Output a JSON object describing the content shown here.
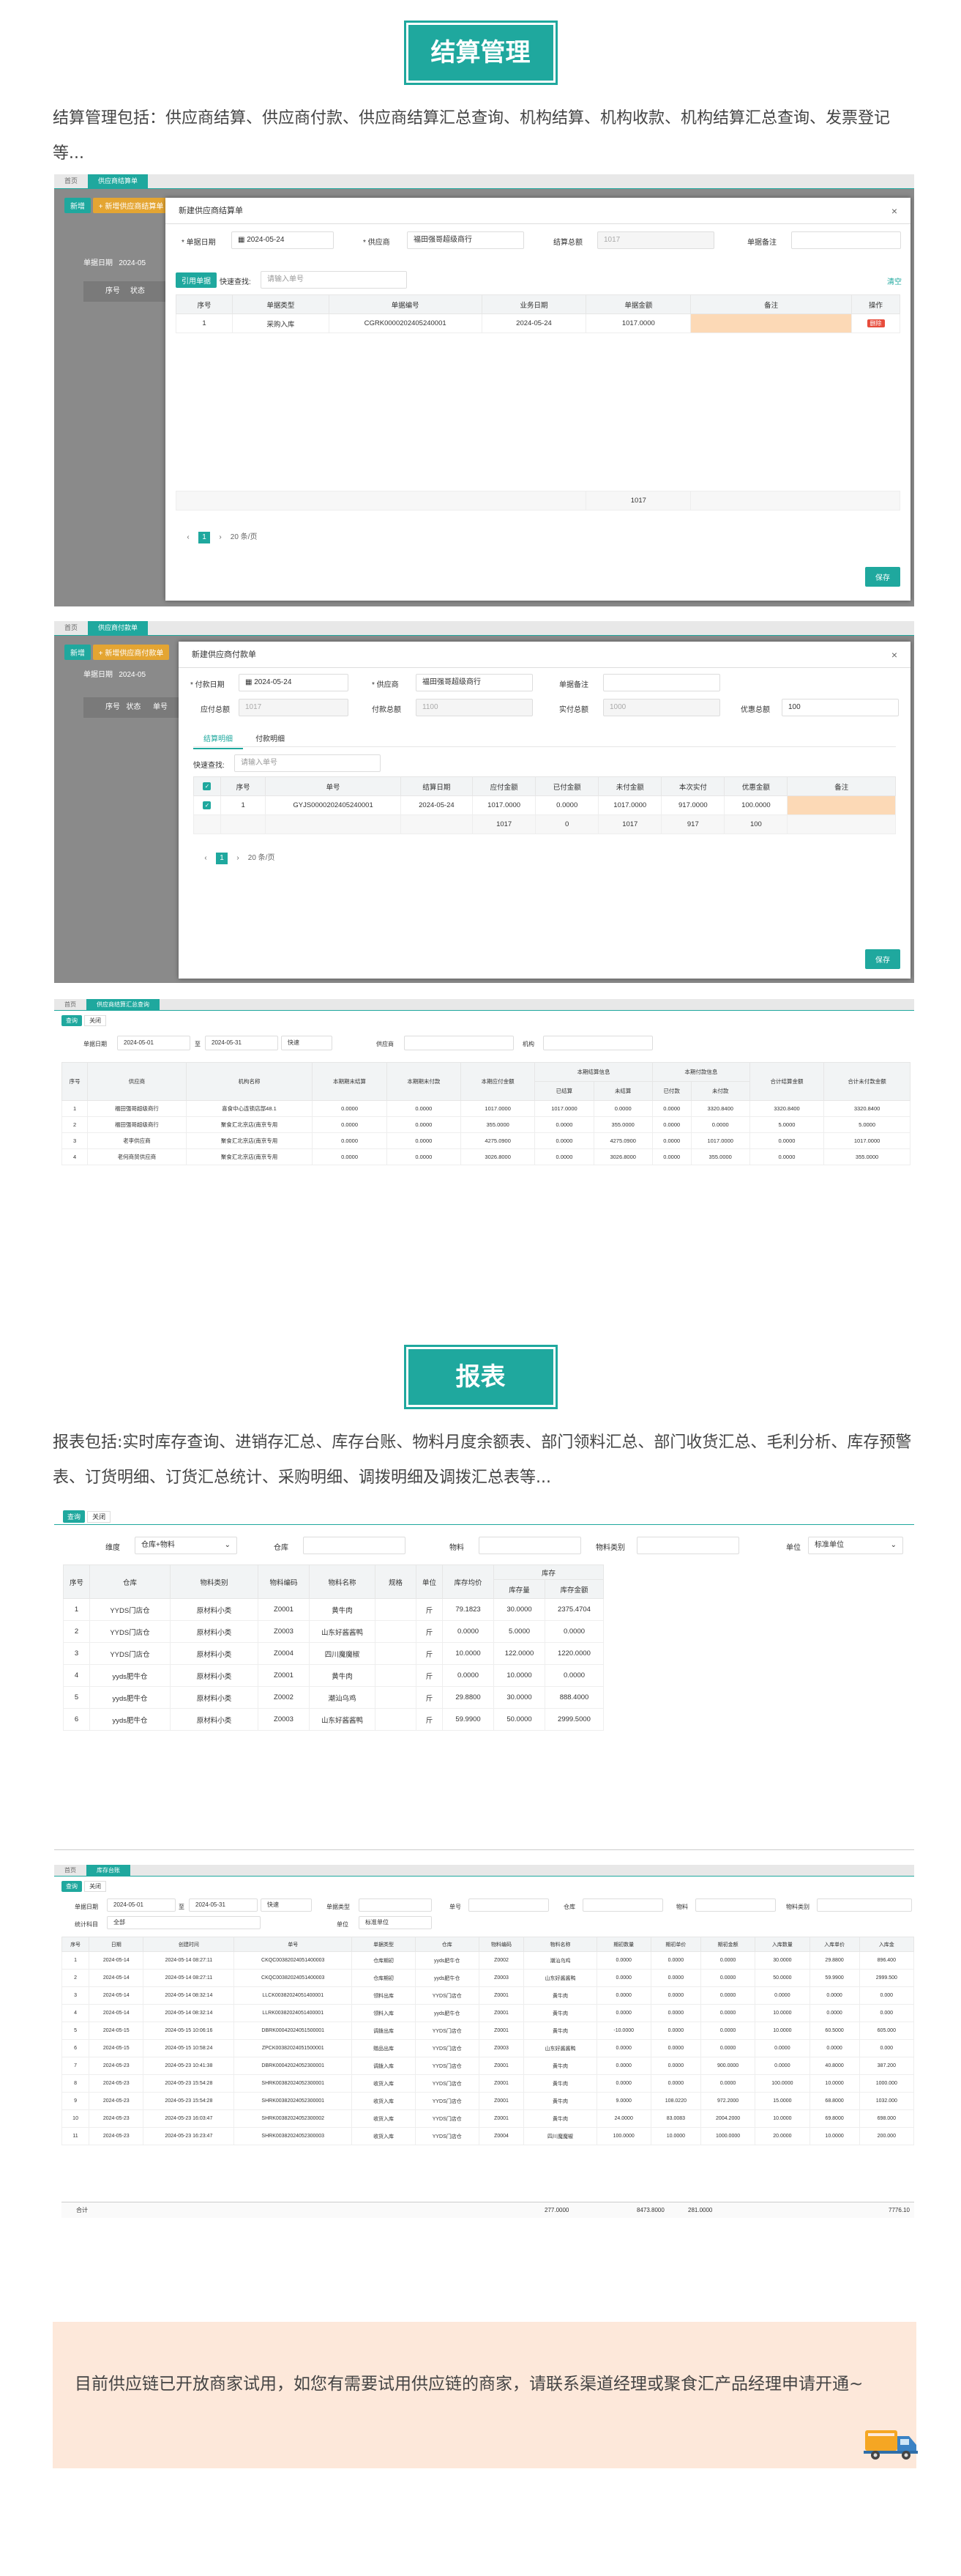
{
  "settle": {
    "title": "结算管理",
    "desc": "结算管理包括：供应商结算、供应商付款、供应商结算汇总查询、机构结算、机构收款、机构结算汇总查询、发票登记等..."
  },
  "shot1": {
    "tabs": [
      "首页",
      "供应商结算单"
    ],
    "btn_new": "新增",
    "btn_new_settle": "+ 新增供应商结算单",
    "bg_label1": "单据日期",
    "bg_value1": "2024-05",
    "bg_col1": "序号",
    "bg_col2": "状态",
    "modal_title": "新建供应商结算单",
    "f_date_label": "* 单据日期",
    "f_date": "2024-05-24",
    "f_supplier_label": "* 供应商",
    "f_supplier": "福田强哥超级商行",
    "f_total_label": "结算总额",
    "f_total": "1017",
    "f_remark_label": "单据备注",
    "btn_import": "引用单据",
    "quick_label": "快速查找:",
    "quick_ph": "请输入单号",
    "clear": "清空",
    "cols": [
      "序号",
      "单据类型",
      "单据编号",
      "业务日期",
      "单据金额",
      "备注",
      "操作"
    ],
    "rows": [
      [
        "1",
        "采购入库",
        "CGRK0000202405240001",
        "2024-05-24",
        "1017.0000",
        "",
        "删除"
      ]
    ],
    "sum": "1017",
    "page_size": "20 条/页",
    "save": "保存"
  },
  "shot2": {
    "tabs": [
      "首页",
      "供应商付款单"
    ],
    "btn_new": "新增",
    "btn_new_pay": "+ 新增供应商付款单",
    "bg_label1": "单据日期",
    "bg_value1": "2024-05",
    "bg_col1": "序号",
    "bg_col2": "状态",
    "bg_col3": "单号",
    "modal_title": "新建供应商付款单",
    "f_date_label": "* 付款日期",
    "f_date": "2024-05-24",
    "f_supplier_label": "* 供应商",
    "f_supplier": "福田强哥超级商行",
    "f_remark_label": "单据备注",
    "f_due_label": "应付总额",
    "f_due": "1017",
    "f_paid_label": "付款总额",
    "f_paid": "1100",
    "f_real_label": "实付总额",
    "f_real": "1000",
    "f_disc_label": "优惠总额",
    "f_disc": "100",
    "tab_a": "结算明细",
    "tab_b": "付款明细",
    "quick_label": "快速查找:",
    "quick_ph": "请输入单号",
    "cols": [
      "",
      "序号",
      "单号",
      "结算日期",
      "应付金额",
      "已付金额",
      "未付金额",
      "本次实付",
      "优惠金额",
      "备注"
    ],
    "rows": [
      [
        "✓",
        "1",
        "GYJS0000202405240001",
        "2024-05-24",
        "1017.0000",
        "0.0000",
        "1017.0000",
        "917.0000",
        "100.0000",
        ""
      ]
    ],
    "sum": [
      "",
      "",
      "",
      "",
      "1017",
      "0",
      "1017",
      "917",
      "100",
      ""
    ],
    "page_size": "20 条/页",
    "save": "保存"
  },
  "shot3": {
    "tabs": [
      "首页",
      "供应商结算汇总查询"
    ],
    "btn_query": "查询",
    "btn_close": "关闭",
    "f_date_label": "单据日期",
    "f_from": "2024-05-01",
    "to": "至",
    "f_to": "2024-05-31",
    "f_quick": "快速",
    "f_supplier_label": "供应商",
    "f_org_label": "机构",
    "g1": "本期结算信息",
    "g2": "本期付款信息",
    "cols": [
      "序号",
      "供应商",
      "机构名称",
      "本期期末结算",
      "本期期末付款",
      "本期应付金额",
      "已结算",
      "未结算",
      "已付款",
      "未付款",
      "合计结算金额",
      "合计未付款金额"
    ],
    "rows": [
      [
        "1",
        "福田强哥超级商行",
        "喜食中心连锁店部48.1",
        "0.0000",
        "0.0000",
        "1017.0000",
        "1017.0000",
        "0.0000",
        "0.0000",
        "3320.8400",
        "3320.8400",
        "3320.8400"
      ],
      [
        "2",
        "福田强哥超级商行",
        "聚食汇北京店(南京专用",
        "0.0000",
        "0.0000",
        "355.0000",
        "0.0000",
        "355.0000",
        "0.0000",
        "0.0000",
        "5.0000",
        "5.0000"
      ],
      [
        "3",
        "老李供应商",
        "聚食汇北京店(南京专用",
        "0.0000",
        "0.0000",
        "4275.0900",
        "0.0000",
        "4275.0900",
        "0.0000",
        "1017.0000",
        "0.0000",
        "1017.0000"
      ],
      [
        "4",
        "老何商贸供应商",
        "聚食汇北京店(南京专用",
        "0.0000",
        "0.0000",
        "3026.8000",
        "0.0000",
        "3026.8000",
        "0.0000",
        "355.0000",
        "0.0000",
        "355.0000"
      ]
    ]
  },
  "report": {
    "title": "报表",
    "desc": "报表包括:实时库存查询、进销存汇总、库存台账、物料月度余额表、部门领料汇总、部门收货汇总、毛利分析、库存预警表、订货明细、订货汇总统计、采购明细、调拨明细及调拨汇总表等..."
  },
  "shot4": {
    "tabs": [
      "首页",
      "即时库存查询"
    ],
    "btn_query": "查询",
    "btn_close": "关闭",
    "f_dim_label": "维度",
    "f_dim": "仓库+物料",
    "f_wh_label": "仓库",
    "f_mat_label": "物料",
    "f_cat_label": "物料类别",
    "f_unit_label": "单位",
    "f_unit": "标准单位",
    "g1": "库存",
    "cols": [
      "序号",
      "仓库",
      "物料类别",
      "物料编码",
      "物料名称",
      "规格",
      "单位",
      "库存均价",
      "库存量",
      "库存金额"
    ],
    "rows": [
      [
        "1",
        "YYDS门店仓",
        "原材料小类",
        "Z0001",
        "黄牛肉",
        "",
        "斤",
        "79.1823",
        "30.0000",
        "2375.4704"
      ],
      [
        "2",
        "YYDS门店仓",
        "原材料小类",
        "Z0003",
        "山东好酱酱鸭",
        "",
        "斤",
        "0.0000",
        "5.0000",
        "0.0000"
      ],
      [
        "3",
        "YYDS门店仓",
        "原材料小类",
        "Z0004",
        "四川魔魔椒",
        "",
        "斤",
        "10.0000",
        "122.0000",
        "1220.0000"
      ],
      [
        "4",
        "yyds肥牛仓",
        "原材料小类",
        "Z0001",
        "黄牛肉",
        "",
        "斤",
        "0.0000",
        "10.0000",
        "0.0000"
      ],
      [
        "5",
        "yyds肥牛仓",
        "原材料小类",
        "Z0002",
        "潮汕乌鸡",
        "",
        "斤",
        "29.8800",
        "30.0000",
        "888.4000"
      ],
      [
        "6",
        "yyds肥牛仓",
        "原材料小类",
        "Z0003",
        "山东好酱酱鸭",
        "",
        "斤",
        "59.9900",
        "50.0000",
        "2999.5000"
      ]
    ]
  },
  "shot5": {
    "tabs": [
      "首页",
      "库存台账"
    ],
    "btn_query": "查询",
    "btn_close": "关闭",
    "f_date_label": "单据日期",
    "f_from": "2024-05-01",
    "to": "至",
    "f_to": "2024-05-31",
    "f_quick": "快速",
    "f_type_label": "单据类型",
    "f_no_label": "单号",
    "f_wh_label": "仓库",
    "f_mat_label": "物料",
    "f_cat_label": "物料类别",
    "f_sum_label": "统计科目",
    "f_sum": "全部",
    "f_unit_label": "单位",
    "f_unit": "标准单位",
    "cols": [
      "序号",
      "日期",
      "创建时间",
      "单号",
      "单据类型",
      "仓库",
      "物料编码",
      "物料名称",
      "期初数量",
      "期初单价",
      "期初金额",
      "入库数量",
      "入库单价",
      "入库金"
    ],
    "rows": [
      [
        "1",
        "2024-05-14",
        "2024-05-14 08:27:11",
        "CKQC00382024051400003",
        "仓库期初",
        "yyds肥牛仓",
        "Z0002",
        "潮汕乌鸡",
        "0.0000",
        "0.0000",
        "0.0000",
        "30.0000",
        "29.8800",
        "896.400"
      ],
      [
        "2",
        "2024-05-14",
        "2024-05-14 08:27:11",
        "CKQC00382024051400003",
        "仓库期初",
        "yyds肥牛仓",
        "Z0003",
        "山东好酱酱鸭",
        "0.0000",
        "0.0000",
        "0.0000",
        "50.0000",
        "59.9900",
        "2999.500"
      ],
      [
        "3",
        "2024-05-14",
        "2024-05-14 08:32:14",
        "LLCK00382024051400001",
        "领料出库",
        "YYDS门店仓",
        "Z0001",
        "黄牛肉",
        "0.0000",
        "0.0000",
        "0.0000",
        "0.0000",
        "0.0000",
        "0.000"
      ],
      [
        "4",
        "2024-05-14",
        "2024-05-14 08:32:14",
        "LLRK00382024051400001",
        "领料入库",
        "yyds肥牛仓",
        "Z0001",
        "黄牛肉",
        "0.0000",
        "0.0000",
        "0.0000",
        "10.0000",
        "0.0000",
        "0.000"
      ],
      [
        "5",
        "2024-05-15",
        "2024-05-15 10:06:16",
        "DBRK00042024051500001",
        "调拨出库",
        "YYDS门店仓",
        "Z0001",
        "黄牛肉",
        "-10.0000",
        "0.0000",
        "0.0000",
        "10.0000",
        "60.5000",
        "605.000"
      ],
      [
        "6",
        "2024-05-15",
        "2024-05-15 10:58:24",
        "ZPCK00382024051500001",
        "赠品出库",
        "YYDS门店仓",
        "Z0003",
        "山东好酱酱鸭",
        "0.0000",
        "0.0000",
        "0.0000",
        "0.0000",
        "0.0000",
        "0.000"
      ],
      [
        "7",
        "2024-05-23",
        "2024-05-23 10:41:38",
        "DBRK00042024052300001",
        "调拨入库",
        "YYDS门店仓",
        "Z0001",
        "黄牛肉",
        "0.0000",
        "0.0000",
        "900.0000",
        "0.0000",
        "40.8000",
        "387.200"
      ],
      [
        "8",
        "2024-05-23",
        "2024-05-23 15:54:28",
        "SHRK00382024052300001",
        "收货入库",
        "YYDS门店仓",
        "Z0001",
        "黄牛肉",
        "0.0000",
        "0.0000",
        "0.0000",
        "100.0000",
        "10.0000",
        "1000.000"
      ],
      [
        "9",
        "2024-05-23",
        "2024-05-23 15:54:28",
        "SHRK00382024052300001",
        "收货入库",
        "YYDS门店仓",
        "Z0001",
        "黄牛肉",
        "9.0000",
        "108.0220",
        "972.2000",
        "15.0000",
        "68.8000",
        "1032.000"
      ],
      [
        "10",
        "2024-05-23",
        "2024-05-23 16:03:47",
        "SHRK00382024052300002",
        "收货入库",
        "YYDS门店仓",
        "Z0001",
        "黄牛肉",
        "24.0000",
        "83.0083",
        "2004.2000",
        "10.0000",
        "69.8000",
        "698.000"
      ],
      [
        "11",
        "2024-05-23",
        "2024-05-23 16:23:47",
        "SHRK00382024052300003",
        "收货入库",
        "YYDS门店仓",
        "Z0004",
        "四川魔魔椒",
        "100.0000",
        "10.0000",
        "1000.0000",
        "20.0000",
        "10.0000",
        "200.000"
      ]
    ],
    "total_label": "合计",
    "total": [
      "277.0000",
      "",
      "8473.8000",
      "281.0000",
      "",
      "7776.10"
    ]
  },
  "note": {
    "text": "目前供应链已开放商家试用，如您有需要试用供应链的商家，请联系渠道经理或聚食汇产品经理申请开通~"
  },
  "colors": {
    "accent": "#1fa89e",
    "orange": "#e4a532",
    "note_bg": "#fde8da"
  }
}
